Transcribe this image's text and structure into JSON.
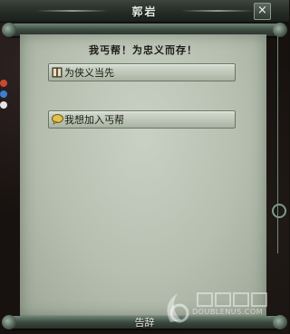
{
  "window": {
    "title": "郭岩",
    "close_symbol": "×"
  },
  "dialog": {
    "greeting": "我丐帮！为忠义而存！",
    "options": [
      {
        "icon": "book-icon",
        "label": "为侠义当先"
      },
      {
        "icon": "chat-bubble-icon",
        "label": "我想加入丐帮"
      }
    ],
    "leave_label": "告辞"
  },
  "watermark": {
    "text": "DOUBLENUS.COM"
  },
  "colors": {
    "paper": "#bcc5b6",
    "titlebar": "#2b322d",
    "rod": "#4f6456",
    "text": "#1d1b17"
  }
}
